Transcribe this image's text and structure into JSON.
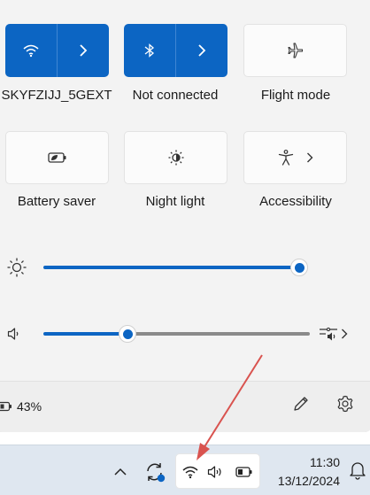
{
  "quick_settings": {
    "wifi": {
      "label": "SKYFZIJJ_5GEXT",
      "icon": "wifi-icon",
      "active": true
    },
    "bluetooth": {
      "label": "Not connected",
      "icon": "bluetooth-icon",
      "active": true
    },
    "flight_mode": {
      "label": "Flight mode",
      "icon": "airplane-icon",
      "active": false
    },
    "battery_saver": {
      "label": "Battery saver",
      "icon": "battery-leaf-icon",
      "active": false
    },
    "night_light": {
      "label": "Night light",
      "icon": "night-light-icon",
      "active": false
    },
    "accessibility": {
      "label": "Accessibility",
      "icon": "accessibility-icon",
      "active": false
    }
  },
  "sliders": {
    "brightness": {
      "icon": "brightness-icon",
      "level_percent": 100
    },
    "volume": {
      "icon": "speaker-icon",
      "level_percent": 32
    }
  },
  "footer": {
    "battery_percent": "43%",
    "edit_icon": "pencil-icon",
    "settings_icon": "gear-icon"
  },
  "taskbar": {
    "time": "11:30",
    "date": "13/12/2024",
    "tray_icons": [
      "chevron-up-icon",
      "sync-icon",
      "wifi-icon",
      "speaker-icon",
      "battery-icon"
    ]
  },
  "colors": {
    "accent": "#0c65c3",
    "panel": "#f3f3f3",
    "annotation_arrow": "#d9534f"
  }
}
